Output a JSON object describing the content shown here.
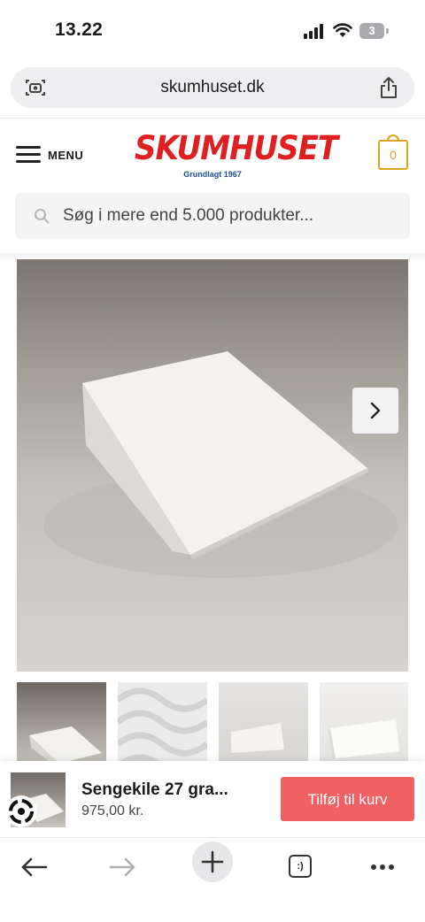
{
  "status_bar": {
    "time": "13.22",
    "battery": "3"
  },
  "browser": {
    "url": "skumhuset.dk"
  },
  "header": {
    "menu_label": "MENU",
    "logo_text": "SKUMHUSET",
    "logo_tagline": "Grundlagt 1967",
    "cart_count": "0",
    "accent_color": "#d9a520",
    "brand_color": "#e02020"
  },
  "search": {
    "placeholder": "Søg i mere end 5.000 produkter..."
  },
  "gallery": {
    "thumbnails": [
      "wedge-photo",
      "wave-foam-photo",
      "wedge-side-photo",
      "wedge-upright-photo"
    ]
  },
  "sticky_cart": {
    "product_title": "Sengekile 27 gra...",
    "price": "975,00  kr.",
    "add_button": "Tilføj til kurv",
    "button_color": "#ef6163"
  },
  "toolbar": {
    "items": [
      "back-icon",
      "forward-icon",
      "new-tab-icon",
      "tabs-icon",
      "more-icon"
    ],
    "tabs_label": ":)"
  }
}
